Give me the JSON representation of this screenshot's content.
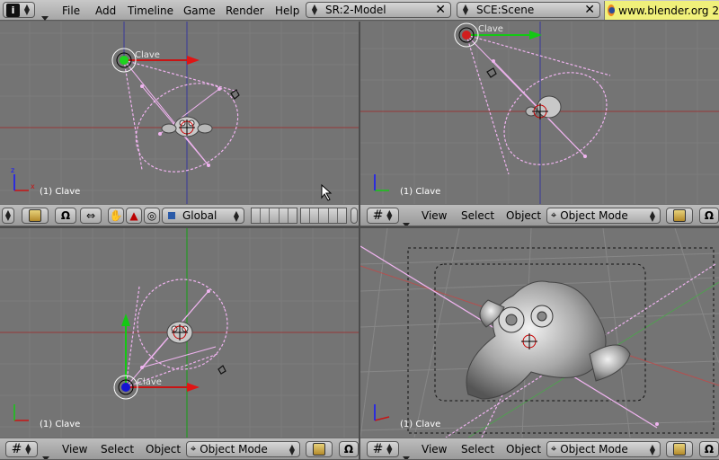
{
  "topbar": {
    "info_icon": "info-icon",
    "menus": [
      "File",
      "Add",
      "Timeline",
      "Game",
      "Render",
      "Help"
    ],
    "screen_field": "SR:2-Model",
    "scene_field": "SCE:Scene",
    "website": "www.blender.org 2"
  },
  "viewports": {
    "top_left": {
      "object_label": "(1) Clave",
      "lamp_label": "Clave"
    },
    "top_right": {
      "object_label": "(1) Clave",
      "lamp_label": "Clave"
    },
    "bottom_left": {
      "object_label": "(1) Clave",
      "lamp_label": "Clave"
    },
    "bottom_right": {
      "object_label": "(1) Clave"
    }
  },
  "header_top_left": {
    "orientation": "Global"
  },
  "header_views": {
    "view": "View",
    "select": "Select",
    "object": "Object",
    "mode": "Object Mode"
  },
  "colors": {
    "viewport_bg": "#747474",
    "header_bg": "#a9a9a9",
    "selected_wire": "#f0b4f0",
    "axis_x": "#c8141e",
    "axis_y": "#14c814",
    "axis_z": "#1414ff",
    "website_bg": "#f0f07a"
  }
}
